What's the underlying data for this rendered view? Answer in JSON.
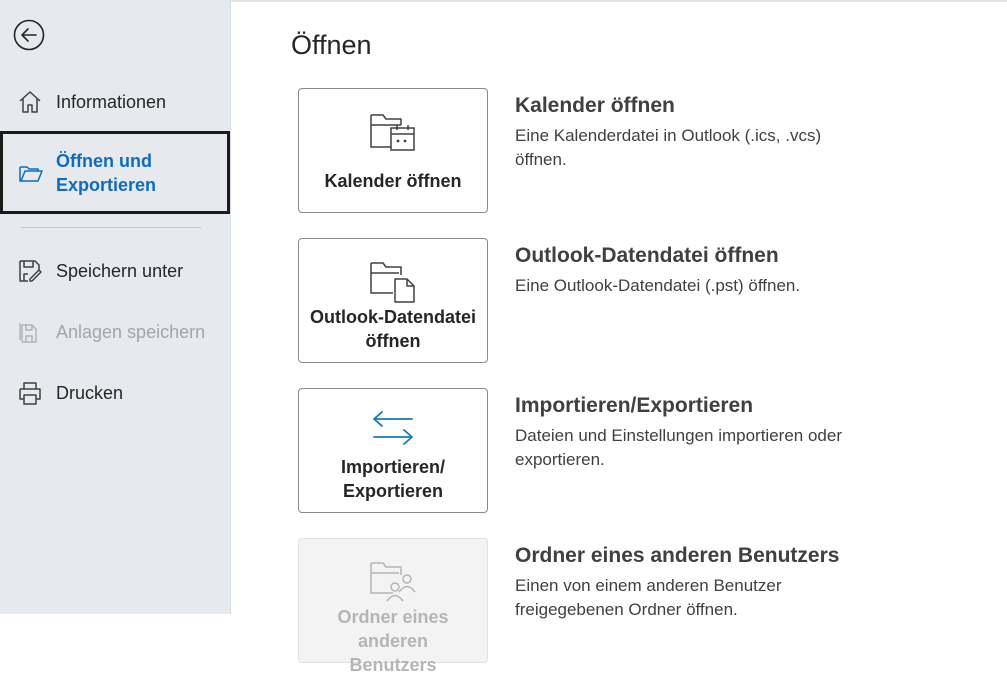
{
  "sidebar": {
    "items": [
      {
        "label": "Informationen",
        "icon": "home-icon"
      },
      {
        "label": "Öffnen und Exportieren",
        "icon": "folder-open-icon",
        "selected": true
      },
      {
        "label": "Speichern unter",
        "icon": "save-as-icon"
      },
      {
        "label": "Anlagen speichern",
        "icon": "save-attachments-icon",
        "disabled": true
      },
      {
        "label": "Drucken",
        "icon": "printer-icon"
      }
    ],
    "back_icon": "back-arrow-icon"
  },
  "main": {
    "title": "Öffnen",
    "options": [
      {
        "tile_label": "Kalender öffnen",
        "icon": "calendar-folder-icon",
        "title": "Kalender öffnen",
        "description": "Eine Kalenderdatei in Outlook (.ics, .vcs) öffnen."
      },
      {
        "tile_label": "Outlook-Datendatei öffnen",
        "icon": "data-file-folder-icon",
        "title": "Outlook-Datendatei öffnen",
        "description": "Eine Outlook-Datendatei (.pst) öffnen."
      },
      {
        "tile_label": "Importieren/ Exportieren",
        "icon": "import-export-arrows-icon",
        "title": "Importieren/Exportieren",
        "description": "Dateien und Einstellungen importieren oder exportieren."
      },
      {
        "tile_label": "Ordner eines anderen Benutzers",
        "icon": "shared-folder-icon",
        "title": "Ordner eines anderen Benutzers",
        "description": "Einen von einem anderen Benutzer freigegebenen Ordner öffnen.",
        "disabled": true
      }
    ]
  },
  "colors": {
    "sidebar_bg": "#e6e9ee",
    "accent": "#0f6cbd",
    "selected_border": "#1b1b1b",
    "disabled_text": "#a2a6ab"
  }
}
